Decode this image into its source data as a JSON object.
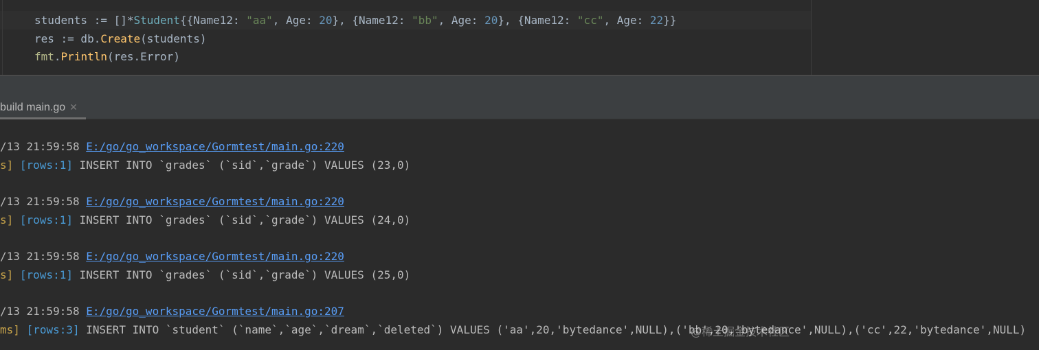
{
  "editor": {
    "lines": [
      {
        "parts": [
          "students := []*",
          "Student",
          "{{Name12: ",
          "\"aa\"",
          ", Age: ",
          "20",
          "}, {Name12: ",
          "\"bb\"",
          ", Age: ",
          "20",
          "}, {Name12: ",
          "\"cc\"",
          ", Age: ",
          "22",
          "}}"
        ]
      },
      {
        "parts": [
          "res := db.",
          "Create",
          "(students)"
        ]
      },
      {
        "parts": [
          "fmt",
          ".",
          "Println",
          "(res.Error)"
        ]
      }
    ]
  },
  "run_tab": {
    "label": "build main.go",
    "close_icon": "close-icon"
  },
  "console": {
    "entries": [
      {
        "time": "/13 21:59:58 ",
        "link": "E:/go/go_workspace/Gormtest/main.go:220",
        "dur": "s]",
        "rows": "[rows:1]",
        "sql": " INSERT INTO `grades` (`sid`,`grade`) VALUES (23,0)"
      },
      {
        "time": "/13 21:59:58 ",
        "link": "E:/go/go_workspace/Gormtest/main.go:220",
        "dur": "s]",
        "rows": "[rows:1]",
        "sql": " INSERT INTO `grades` (`sid`,`grade`) VALUES (24,0)"
      },
      {
        "time": "/13 21:59:58 ",
        "link": "E:/go/go_workspace/Gormtest/main.go:220",
        "dur": "s]",
        "rows": "[rows:1]",
        "sql": " INSERT INTO `grades` (`sid`,`grade`) VALUES (25,0)"
      },
      {
        "time": "/13 21:59:58 ",
        "link": "E:/go/go_workspace/Gormtest/main.go:207",
        "dur": "ms]",
        "rows": "[rows:3]",
        "sql": " INSERT INTO `student` (`name`,`age`,`dream`,`deleted`) VALUES ('aa',20,'bytedance',NULL),('bb',20,'bytedance',NULL),('cc',22,'bytedance',NULL)"
      }
    ]
  },
  "watermark": "@稀土掘金技术社区"
}
